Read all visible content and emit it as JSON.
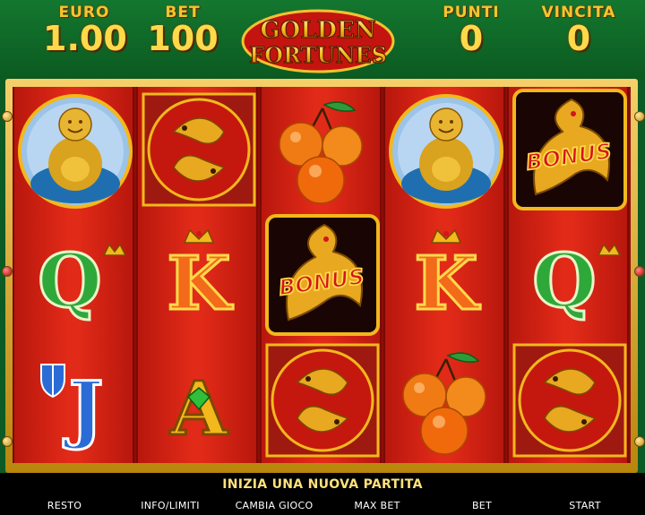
{
  "header": {
    "currency_label": "EURO",
    "currency_value": "1.00",
    "bet_label": "BET",
    "bet_value": "100",
    "points_label": "PUNTI",
    "points_value": "0",
    "win_label": "VINCITA",
    "win_value": "0",
    "logo_line1": "GOLDEN",
    "logo_line2": "FORTUNES"
  },
  "reels": [
    [
      "buddha",
      "letter-q",
      "letter-j"
    ],
    [
      "koi",
      "letter-k",
      "letter-a"
    ],
    [
      "oranges",
      "dragon-bonus",
      "koi"
    ],
    [
      "buddha",
      "letter-k",
      "oranges"
    ],
    [
      "dragon-bonus",
      "letter-q",
      "koi"
    ]
  ],
  "symbols": {
    "letter_q": "Q",
    "letter_k": "K",
    "letter_a": "A",
    "letter_j": "J",
    "bonus": "BONUS"
  },
  "message": "INIZIA UNA NUOVA PARTITA",
  "buttons": {
    "resto": "RESTO",
    "info": "INFO/LIMITI",
    "cambia": "CAMBIA GIOCO",
    "maxbet": "MAX BET",
    "bet": "BET",
    "start": "START"
  },
  "colors": {
    "gold": "#ffd94a",
    "reel_red": "#e12a18",
    "header_green": "#14772f"
  }
}
